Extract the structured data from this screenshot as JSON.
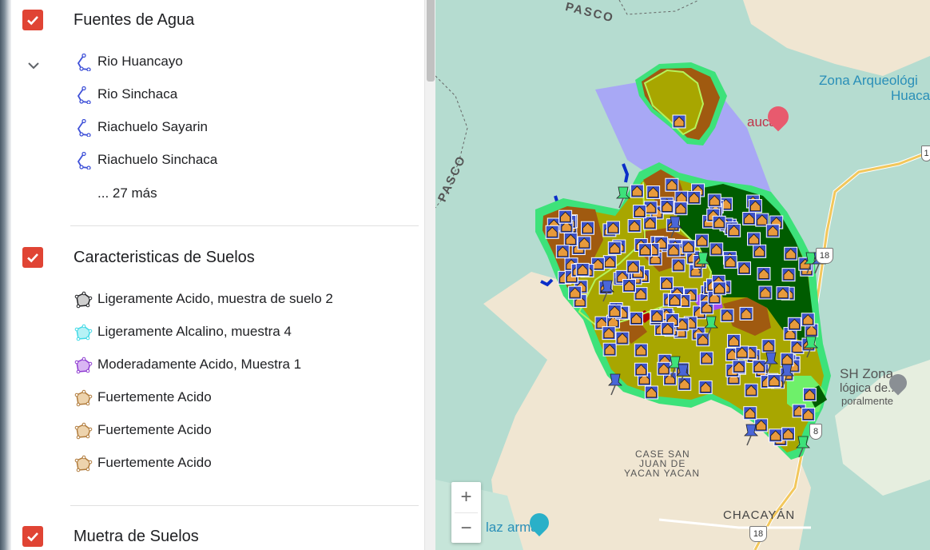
{
  "layers": [
    {
      "title": "Fuentes de Agua",
      "checked": true,
      "items": [
        "Rio Huancayo",
        "Rio Sinchaca",
        "Riachuelo Sayarin",
        "Riachuelo Sinchaca"
      ],
      "more": "... 27 más",
      "icon": "line-path-icon",
      "icon_color": "#3f51d8"
    },
    {
      "title": "Caracteristicas de Suelos",
      "checked": true,
      "items": [
        {
          "label": "Ligeramente Acido, muestra de suelo 2",
          "color": "#202124"
        },
        {
          "label": "Ligeramente Alcalino, muestra 4",
          "color": "#3fd9e6"
        },
        {
          "label": "Moderadamente Acido, Muestra 1",
          "color": "#8e3bd1"
        },
        {
          "label": "Fuertemente Acido",
          "color": "#b07a3a"
        },
        {
          "label": "Fuertemente Acido",
          "color": "#b07a3a"
        },
        {
          "label": "Fuertemente Acido",
          "color": "#b07a3a"
        }
      ],
      "icon": "polygon-icon"
    },
    {
      "title": "Muetra de Suelos",
      "checked": true
    }
  ],
  "map": {
    "labels": {
      "pasco_top": "PASCO",
      "pasco_left": "PASCO",
      "zona1": "Zona Arqueológi",
      "zona2": "Huaca",
      "aucar": "aucar",
      "sh1": "SH Zona",
      "sh2": "lógica de...",
      "sh3": "poralmente",
      "case1": "CASE SAN",
      "case2": "JUAN DE",
      "case3": "YACAN YACAN",
      "chacayan": "CHACAYÁN",
      "plaza": "laz",
      "armas": "armas",
      "route_18": "18",
      "route_18b": "18",
      "route_8": "8",
      "route_1": "1"
    },
    "zoom_in": "+",
    "zoom_out": "−",
    "colors": {
      "base": "#b5dcd0",
      "sand": "#f0e6d2",
      "olive": "#a8a600",
      "brown": "#a05a10",
      "dark_green": "#005c00",
      "lavender": "#a8a8f5",
      "outline": "#3de27a",
      "house": "#e89a3c"
    }
  }
}
